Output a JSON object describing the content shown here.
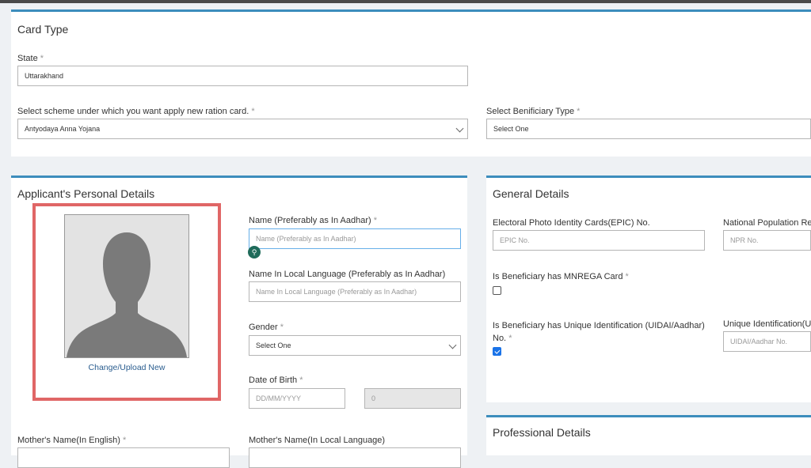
{
  "card_type": {
    "title": "Card Type",
    "state_label": "State",
    "state_value": "Uttarakhand",
    "scheme_label": "Select scheme under which you want apply new ration card.",
    "scheme_value": "Antyodaya Anna Yojana",
    "beneficiary_label": "Select Benificiary Type",
    "beneficiary_value": "Select One",
    "required_mark": "*"
  },
  "personal": {
    "title": "Applicant's Personal Details",
    "upload_link": "Change/Upload New",
    "name_label": "Name (Preferably as In Aadhar)",
    "name_placeholder": "Name (Preferably as In Aadhar)",
    "local_name_label": "Name In Local Language (Preferably as In Aadhar)",
    "local_name_placeholder": "Name In Local Language (Preferably as In Aadhar)",
    "gender_label": "Gender",
    "gender_value": "Select One",
    "dob_label": "Date of Birth",
    "dob_placeholder": "DD/MM/YYYY",
    "age_value": "0",
    "mother_en_label": "Mother's Name(In English)",
    "mother_local_label": "Mother's Name(In Local Language)"
  },
  "general": {
    "title": "General Details",
    "epic_label": "Electoral Photo Identity Cards(EPIC) No.",
    "epic_placeholder": "EPIC No.",
    "npr_label": "National Population Reg",
    "npr_placeholder": "NPR No.",
    "mnrega_label": "Is Beneficiary has MNREGA Card",
    "mnrega_checked": false,
    "uid_label_line1": "Is Beneficiary has Unique Identification (UIDAI/Aadhar)",
    "uid_label_line2": "No.",
    "uid_checked": true,
    "uid_no_label": "Unique Identification(UI",
    "uid_no_placeholder": "UIDAI/Aadhar No."
  },
  "professional": {
    "title": "Professional Details"
  },
  "colors": {
    "accent": "#3c8dbc",
    "highlight_border": "#e06666",
    "checkbox_checked": "#1a73e8"
  }
}
